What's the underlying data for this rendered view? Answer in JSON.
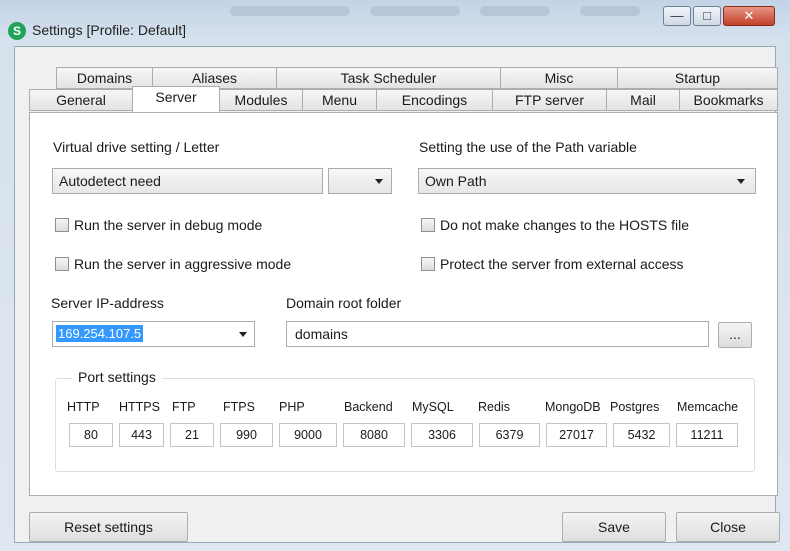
{
  "window": {
    "title": "Settings [Profile: Default]",
    "app_icon_letter": "S",
    "controls": {
      "minimize": "—",
      "maximize": "□",
      "close": "✕"
    }
  },
  "tabs": {
    "row1": [
      "Domains",
      "Aliases",
      "Task Scheduler",
      "Misc",
      "Startup"
    ],
    "row2": [
      "General",
      "Server",
      "Modules",
      "Menu",
      "Encodings",
      "FTP server",
      "Mail",
      "Bookmarks"
    ],
    "active": "Server"
  },
  "server": {
    "virtual_drive_label": "Virtual drive setting / Letter",
    "virtual_drive_value": "Autodetect need",
    "drive_letter_value": "",
    "path_var_label": "Setting the use of the Path variable",
    "path_var_value": "Own Path",
    "checkboxes": {
      "debug_mode": "Run the server in debug mode",
      "aggressive_mode": "Run the server in aggressive mode",
      "no_hosts": "Do not make changes to the HOSTS file",
      "protect_external": "Protect the server from external access"
    },
    "ip_label": "Server IP-address",
    "ip_value": "169.254.107.5",
    "domain_root_label": "Domain root folder",
    "domain_root_value": "domains",
    "browse_label": "...",
    "port_settings_label": "Port settings",
    "ports": [
      {
        "name": "HTTP",
        "value": "80"
      },
      {
        "name": "HTTPS",
        "value": "443"
      },
      {
        "name": "FTP",
        "value": "21"
      },
      {
        "name": "FTPS",
        "value": "990"
      },
      {
        "name": "PHP",
        "value": "9000"
      },
      {
        "name": "Backend",
        "value": "8080"
      },
      {
        "name": "MySQL",
        "value": "3306"
      },
      {
        "name": "Redis",
        "value": "6379"
      },
      {
        "name": "MongoDB",
        "value": "27017"
      },
      {
        "name": "Postgres",
        "value": "5432"
      },
      {
        "name": "Memcache",
        "value": "11211"
      }
    ]
  },
  "footer": {
    "reset": "Reset settings",
    "save": "Save",
    "close": "Close"
  }
}
